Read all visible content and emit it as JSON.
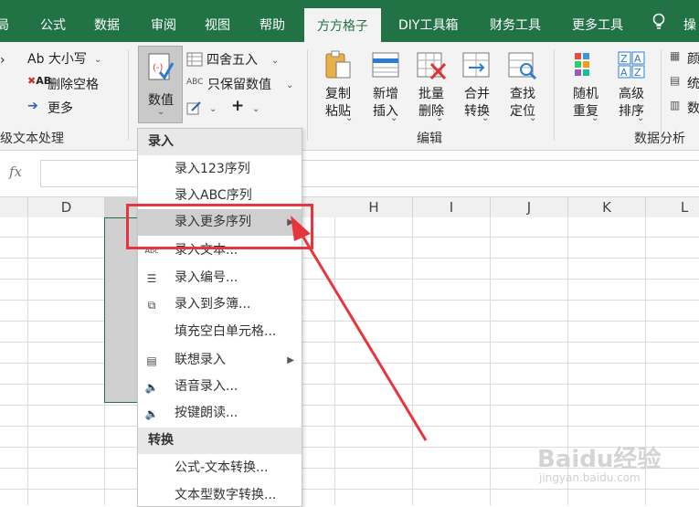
{
  "tabs": {
    "t0": "局",
    "t1": "公式",
    "t2": "数据",
    "t3": "审阅",
    "t4": "视图",
    "t5": "帮助",
    "t6": "方方格子",
    "t7": "DIY工具箱",
    "t8": "财务工具",
    "t9": "更多工具",
    "t10": "操"
  },
  "ribbon": {
    "case_btn": "Ab 大小写",
    "del_space_btn": "删除空格",
    "more_btn": "更多",
    "group_text": "级文本处理",
    "value_btn": "数值",
    "round_btn": "四舍五入",
    "keep_value_btn": "只保留数值",
    "copy_paste_btn": "复制粘贴",
    "insert_btn": "新增插入",
    "batch_delete_btn": "批量删除",
    "merge_btn": "合并转换",
    "find_btn": "查找定位",
    "group_edit": "编辑",
    "random_btn": "随机重复",
    "sort_btn": "高级排序",
    "group_analysis": "数据分析",
    "r1": "颜",
    "r2": "统",
    "r3": "数"
  },
  "formula_bar": {
    "fx": "fx",
    "value": ""
  },
  "columns": [
    "D",
    "",
    "H",
    "I",
    "J",
    "K",
    "L"
  ],
  "menu": {
    "section1": "录入",
    "items1": [
      "录入123序列",
      "录入ABC序列",
      "录入更多序列",
      "录入文本...",
      "录入编号...",
      "录入到多簿...",
      "填充空白单元格...",
      "联想录入",
      "语音录入...",
      "按键朗读..."
    ],
    "section2": "转换",
    "items2": [
      "公式-文本转换...",
      "文本型数字转换..."
    ]
  },
  "watermark": {
    "brand": "Baidu经验",
    "url": "jingyan.baidu.com"
  },
  "colors": {
    "tab_green": "#217346",
    "highlight_red": "#e8353d"
  }
}
